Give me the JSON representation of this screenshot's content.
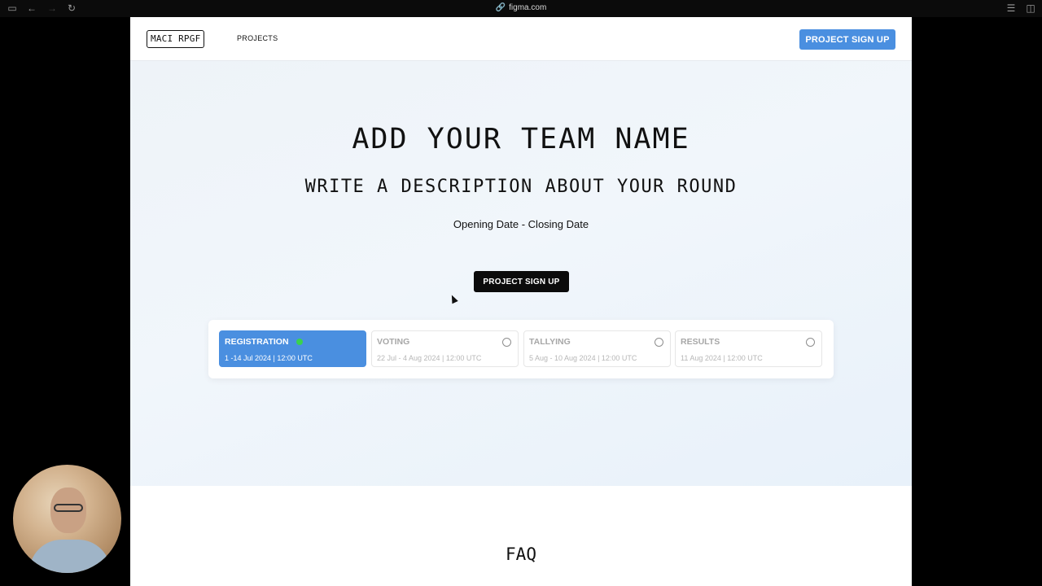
{
  "browser": {
    "url": "figma.com",
    "icons": {
      "sidebar": "sidebar-icon",
      "back": "back-icon",
      "forward": "forward-icon",
      "reload": "reload-icon",
      "link": "link-icon",
      "reader": "reader-icon",
      "split": "split-view-icon"
    }
  },
  "nav": {
    "logo": "MACI RPGF",
    "projects_link": "PROJECTS",
    "cta": "PROJECT SIGN UP"
  },
  "hero": {
    "title": "ADD YOUR TEAM NAME",
    "subtitle": "WRITE A DESCRIPTION ABOUT YOUR ROUND",
    "dates": "Opening Date - Closing Date",
    "cta": "PROJECT SIGN UP"
  },
  "timeline": [
    {
      "label": "REGISTRATION",
      "date": "1 -14 Jul 2024 | 12:00 UTC",
      "active": true
    },
    {
      "label": "VOTING",
      "date": "22 Jul - 4 Aug 2024 | 12:00 UTC",
      "active": false
    },
    {
      "label": "TALLYING",
      "date": "5 Aug - 10 Aug 2024 | 12:00 UTC",
      "active": false
    },
    {
      "label": "RESULTS",
      "date": "11 Aug 2024 | 12:00 UTC",
      "active": false
    }
  ],
  "faq": {
    "title": "FAQ"
  },
  "colors": {
    "accent": "#4a8fe0",
    "active_dot": "#39d24f",
    "dark_button": "#0b0b0b"
  }
}
